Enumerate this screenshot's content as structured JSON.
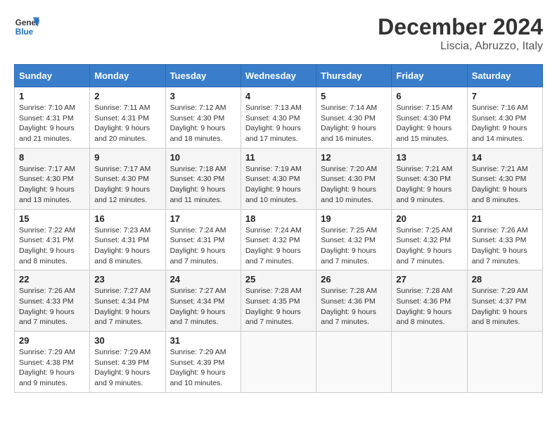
{
  "header": {
    "logo_line1": "General",
    "logo_line2": "Blue",
    "month_title": "December 2024",
    "location": "Liscia, Abruzzo, Italy"
  },
  "days_of_week": [
    "Sunday",
    "Monday",
    "Tuesday",
    "Wednesday",
    "Thursday",
    "Friday",
    "Saturday"
  ],
  "weeks": [
    [
      {
        "day": "1",
        "sunrise": "7:10 AM",
        "sunset": "4:31 PM",
        "daylight_h": "9",
        "daylight_m": "21"
      },
      {
        "day": "2",
        "sunrise": "7:11 AM",
        "sunset": "4:31 PM",
        "daylight_h": "9",
        "daylight_m": "20"
      },
      {
        "day": "3",
        "sunrise": "7:12 AM",
        "sunset": "4:30 PM",
        "daylight_h": "9",
        "daylight_m": "18"
      },
      {
        "day": "4",
        "sunrise": "7:13 AM",
        "sunset": "4:30 PM",
        "daylight_h": "9",
        "daylight_m": "17"
      },
      {
        "day": "5",
        "sunrise": "7:14 AM",
        "sunset": "4:30 PM",
        "daylight_h": "9",
        "daylight_m": "16"
      },
      {
        "day": "6",
        "sunrise": "7:15 AM",
        "sunset": "4:30 PM",
        "daylight_h": "9",
        "daylight_m": "15"
      },
      {
        "day": "7",
        "sunrise": "7:16 AM",
        "sunset": "4:30 PM",
        "daylight_h": "9",
        "daylight_m": "14"
      }
    ],
    [
      {
        "day": "8",
        "sunrise": "7:17 AM",
        "sunset": "4:30 PM",
        "daylight_h": "9",
        "daylight_m": "13"
      },
      {
        "day": "9",
        "sunrise": "7:17 AM",
        "sunset": "4:30 PM",
        "daylight_h": "9",
        "daylight_m": "12"
      },
      {
        "day": "10",
        "sunrise": "7:18 AM",
        "sunset": "4:30 PM",
        "daylight_h": "9",
        "daylight_m": "11"
      },
      {
        "day": "11",
        "sunrise": "7:19 AM",
        "sunset": "4:30 PM",
        "daylight_h": "9",
        "daylight_m": "10"
      },
      {
        "day": "12",
        "sunrise": "7:20 AM",
        "sunset": "4:30 PM",
        "daylight_h": "9",
        "daylight_m": "10"
      },
      {
        "day": "13",
        "sunrise": "7:21 AM",
        "sunset": "4:30 PM",
        "daylight_h": "9",
        "daylight_m": "9"
      },
      {
        "day": "14",
        "sunrise": "7:21 AM",
        "sunset": "4:30 PM",
        "daylight_h": "9",
        "daylight_m": "8"
      }
    ],
    [
      {
        "day": "15",
        "sunrise": "7:22 AM",
        "sunset": "4:31 PM",
        "daylight_h": "9",
        "daylight_m": "8"
      },
      {
        "day": "16",
        "sunrise": "7:23 AM",
        "sunset": "4:31 PM",
        "daylight_h": "9",
        "daylight_m": "8"
      },
      {
        "day": "17",
        "sunrise": "7:24 AM",
        "sunset": "4:31 PM",
        "daylight_h": "9",
        "daylight_m": "7"
      },
      {
        "day": "18",
        "sunrise": "7:24 AM",
        "sunset": "4:32 PM",
        "daylight_h": "9",
        "daylight_m": "7"
      },
      {
        "day": "19",
        "sunrise": "7:25 AM",
        "sunset": "4:32 PM",
        "daylight_h": "9",
        "daylight_m": "7"
      },
      {
        "day": "20",
        "sunrise": "7:25 AM",
        "sunset": "4:32 PM",
        "daylight_h": "9",
        "daylight_m": "7"
      },
      {
        "day": "21",
        "sunrise": "7:26 AM",
        "sunset": "4:33 PM",
        "daylight_h": "9",
        "daylight_m": "7"
      }
    ],
    [
      {
        "day": "22",
        "sunrise": "7:26 AM",
        "sunset": "4:33 PM",
        "daylight_h": "9",
        "daylight_m": "7"
      },
      {
        "day": "23",
        "sunrise": "7:27 AM",
        "sunset": "4:34 PM",
        "daylight_h": "9",
        "daylight_m": "7"
      },
      {
        "day": "24",
        "sunrise": "7:27 AM",
        "sunset": "4:34 PM",
        "daylight_h": "9",
        "daylight_m": "7"
      },
      {
        "day": "25",
        "sunrise": "7:28 AM",
        "sunset": "4:35 PM",
        "daylight_h": "9",
        "daylight_m": "7"
      },
      {
        "day": "26",
        "sunrise": "7:28 AM",
        "sunset": "4:36 PM",
        "daylight_h": "9",
        "daylight_m": "7"
      },
      {
        "day": "27",
        "sunrise": "7:28 AM",
        "sunset": "4:36 PM",
        "daylight_h": "9",
        "daylight_m": "8"
      },
      {
        "day": "28",
        "sunrise": "7:29 AM",
        "sunset": "4:37 PM",
        "daylight_h": "9",
        "daylight_m": "8"
      }
    ],
    [
      {
        "day": "29",
        "sunrise": "7:29 AM",
        "sunset": "4:38 PM",
        "daylight_h": "9",
        "daylight_m": "9"
      },
      {
        "day": "30",
        "sunrise": "7:29 AM",
        "sunset": "4:39 PM",
        "daylight_h": "9",
        "daylight_m": "9"
      },
      {
        "day": "31",
        "sunrise": "7:29 AM",
        "sunset": "4:39 PM",
        "daylight_h": "9",
        "daylight_m": "10"
      },
      null,
      null,
      null,
      null
    ]
  ],
  "labels": {
    "sunrise": "Sunrise:",
    "sunset": "Sunset:",
    "daylight": "Daylight:",
    "hours": "hours",
    "and": "and",
    "minutes": "minutes."
  }
}
